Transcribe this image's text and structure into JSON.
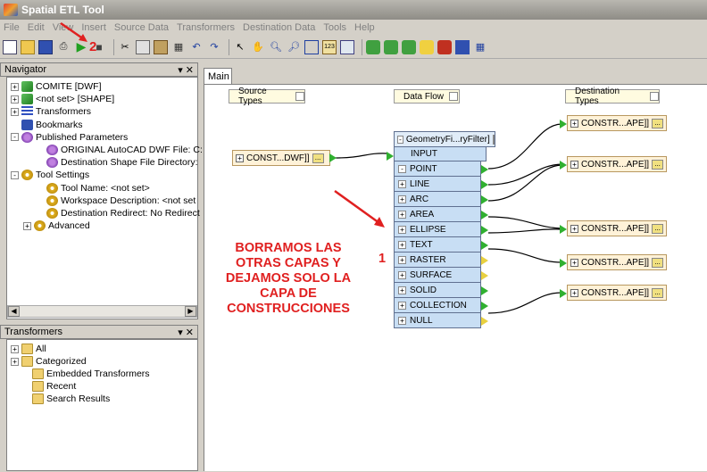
{
  "window": {
    "title": "Spatial ETL Tool"
  },
  "menu": [
    "File",
    "Edit",
    "View",
    "Insert",
    "Source Data",
    "Transformers",
    "Destination Data",
    "Tools",
    "Help"
  ],
  "navigator": {
    "title": "Navigator",
    "close": "▾ ✕",
    "items": [
      {
        "label": "COMITE [DWF]",
        "indent": 0,
        "expander": "+",
        "icon": "green-reader-icon"
      },
      {
        "label": "<not set> [SHAPE]",
        "indent": 0,
        "expander": "+",
        "icon": "green-writer-icon"
      },
      {
        "label": "Transformers",
        "indent": 0,
        "expander": "+",
        "icon": "transformers-icon"
      },
      {
        "label": "Bookmarks",
        "indent": 0,
        "expander": "",
        "icon": "bookmark-icon"
      },
      {
        "label": "Published Parameters",
        "indent": 0,
        "expander": "-",
        "icon": "published-params-icon"
      },
      {
        "label": "ORIGINAL AutoCAD DWF File: C:",
        "indent": 2,
        "expander": "",
        "icon": "param-icon"
      },
      {
        "label": "Destination Shape File Directory:",
        "indent": 2,
        "expander": "",
        "icon": "param-icon"
      },
      {
        "label": "Tool Settings",
        "indent": 0,
        "expander": "-",
        "icon": "settings-icon"
      },
      {
        "label": "Tool Name: <not set>",
        "indent": 2,
        "expander": "",
        "icon": "setting-icon"
      },
      {
        "label": "Workspace Description: <not set",
        "indent": 2,
        "expander": "",
        "icon": "setting-icon"
      },
      {
        "label": "Destination Redirect: No Redirect",
        "indent": 2,
        "expander": "",
        "icon": "setting-icon"
      },
      {
        "label": "Advanced",
        "indent": 1,
        "expander": "+",
        "icon": "setting-icon"
      }
    ]
  },
  "transformers_panel": {
    "title": "Transformers",
    "close": "▾ ✕",
    "items": [
      {
        "label": "All",
        "indent": 0,
        "expander": "+"
      },
      {
        "label": "Categorized",
        "indent": 0,
        "expander": "+"
      },
      {
        "label": "Embedded Transformers",
        "indent": 1,
        "expander": ""
      },
      {
        "label": "Recent",
        "indent": 1,
        "expander": ""
      },
      {
        "label": "Search Results",
        "indent": 1,
        "expander": ""
      }
    ]
  },
  "canvas": {
    "tab": "Main",
    "headers": {
      "source": "Source Types",
      "flow": "Data Flow",
      "dest": "Destination Types"
    },
    "source_feature": "CONST...DWF]]",
    "transformer": {
      "name": "GeometryFi...ryFilter]",
      "input": "INPUT",
      "ports": [
        "POINT",
        "LINE",
        "ARC",
        "AREA",
        "ELLIPSE",
        "TEXT",
        "RASTER",
        "SURFACE",
        "SOLID",
        "COLLECTION",
        "NULL"
      ],
      "port_colors": [
        "green",
        "green",
        "green",
        "green",
        "green",
        "green",
        "yellow",
        "yellow",
        "green",
        "green",
        "yellow"
      ]
    },
    "destinations": [
      "CONSTR...APE]]",
      "CONSTR...APE]]",
      "CONSTR...APE]]",
      "CONSTR...APE]]",
      "CONSTR...APE]]"
    ]
  },
  "annotation": {
    "lines": [
      "BORRAMOS LAS",
      "OTRAS CAPAS Y",
      "DEJAMOS SOLO LA",
      "CAPA DE",
      "CONSTRUCCIONES"
    ],
    "number_top": "2",
    "number_mid": "1",
    "color": "#e02020"
  }
}
